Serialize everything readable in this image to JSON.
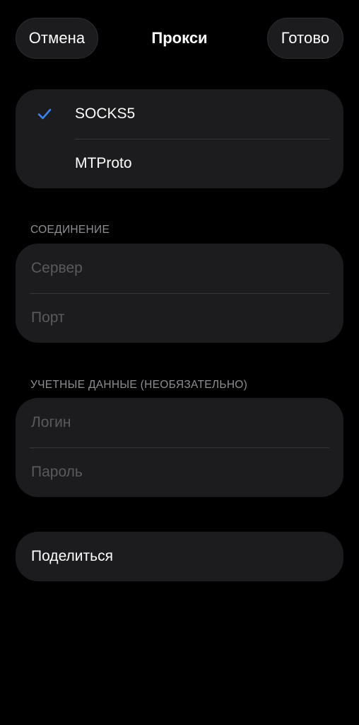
{
  "nav": {
    "cancel_label": "Отмена",
    "title": "Прокси",
    "done_label": "Готово"
  },
  "protocol": {
    "options": [
      {
        "label": "SOCKS5",
        "selected": true
      },
      {
        "label": "MTProto",
        "selected": false
      }
    ]
  },
  "connection": {
    "header": "СОЕДИНЕНИЕ",
    "server_placeholder": "Сервер",
    "port_placeholder": "Порт"
  },
  "credentials": {
    "header": "УЧЕТНЫЕ ДАННЫЕ (НЕОБЯЗАТЕЛЬНО)",
    "login_placeholder": "Логин",
    "password_placeholder": "Пароль"
  },
  "share": {
    "label": "Поделиться"
  },
  "colors": {
    "background": "#000000",
    "card": "#1c1c1e",
    "accent": "#3a82f7",
    "placeholder": "#5a5a5e",
    "header": "#8e8e93"
  }
}
